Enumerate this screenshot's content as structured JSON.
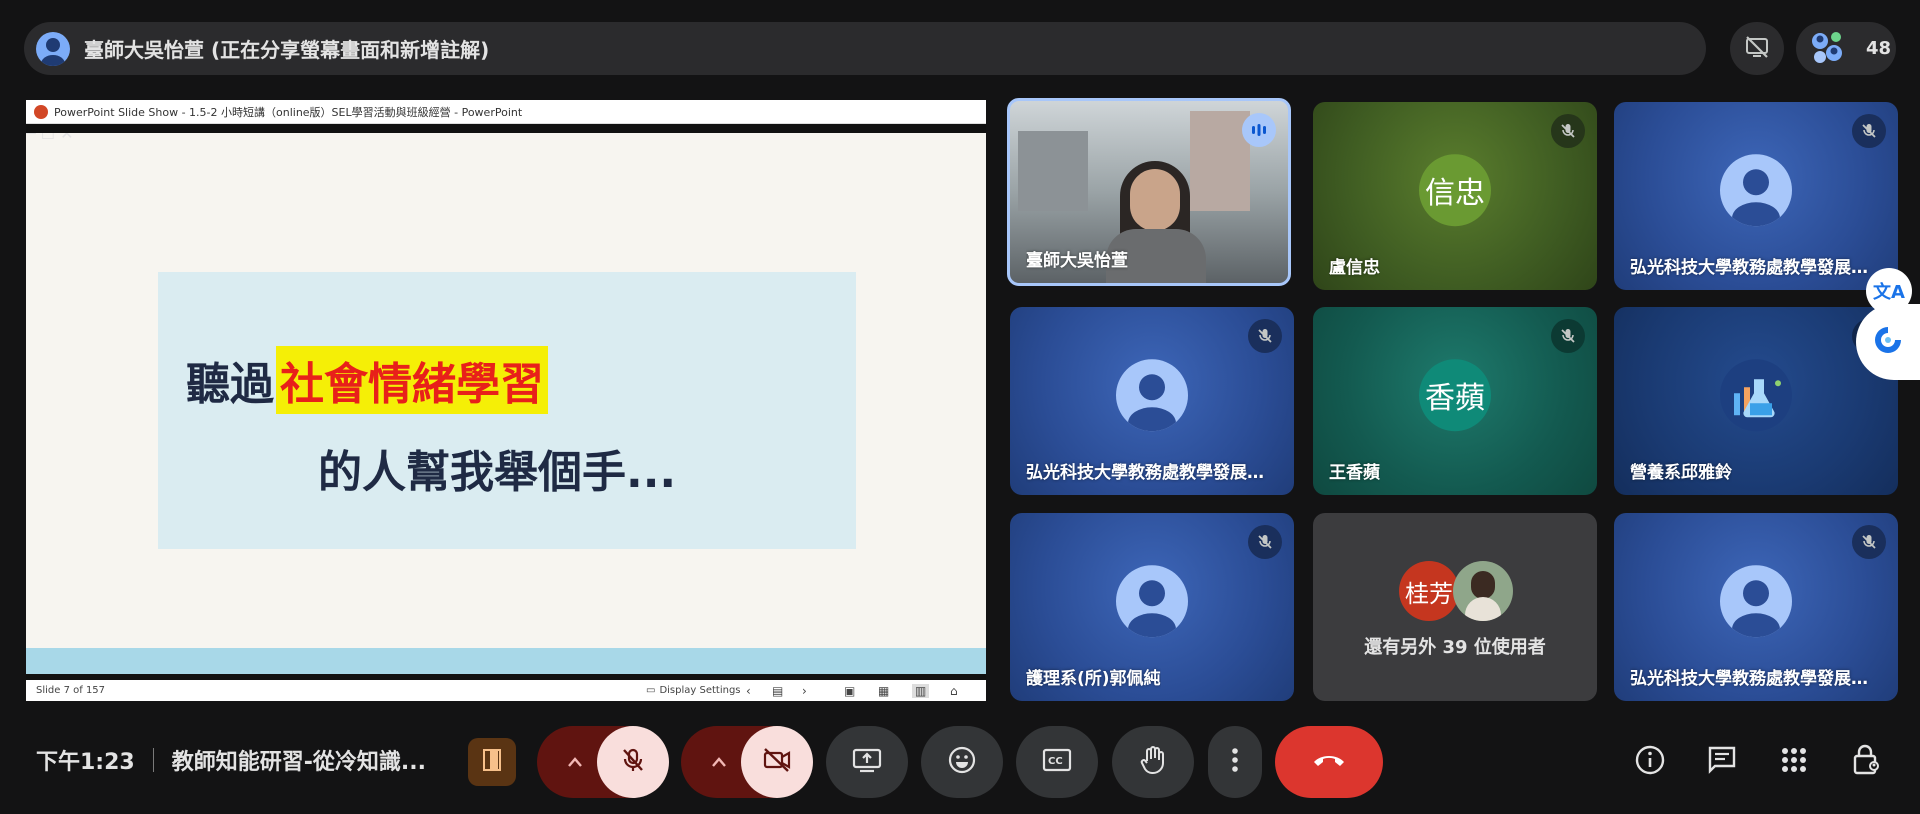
{
  "presenter": {
    "title": "臺師大吳怡萱 (正在分享螢幕畫面和新增註解)"
  },
  "participants_count": "48",
  "share": {
    "window_title": "PowerPoint Slide Show  -  1.5-2 小時短講（online版）SEL學習活動與班級經營 - PowerPoint",
    "slide_line1_plain": "聽過",
    "slide_line1_highlight": "社會情緒學習",
    "slide_line2": "的人幫我舉個手...",
    "status_slide": "Slide 7 of 157",
    "status_display": "Display Settings"
  },
  "tiles": [
    {
      "name": "臺師大吳怡萱"
    },
    {
      "name": "盧信忠",
      "initials": "信忠"
    },
    {
      "name": "弘光科技大學教務處教學發展中心..."
    },
    {
      "name": "弘光科技大學教務處教學發展中心..."
    },
    {
      "name": "王香蘋",
      "initials": "香蘋"
    },
    {
      "name": "營養系邱雅鈴"
    },
    {
      "name": "護理系(所)郭佩純"
    },
    {
      "others_text": "還有另外 39 位使用者",
      "others_initials": "桂芳"
    },
    {
      "name": "弘光科技大學教務處教學發展中心..."
    }
  ],
  "bottom": {
    "time": "下午1:23",
    "meeting_title": "教師知能研習-從冷知識..."
  },
  "colors": {
    "bg": "#131314",
    "end_call": "#dc362e",
    "muted_bg": "#f9dedc",
    "muted_chevron_bg": "#601410",
    "accent_blue": "#a8c7fa"
  }
}
